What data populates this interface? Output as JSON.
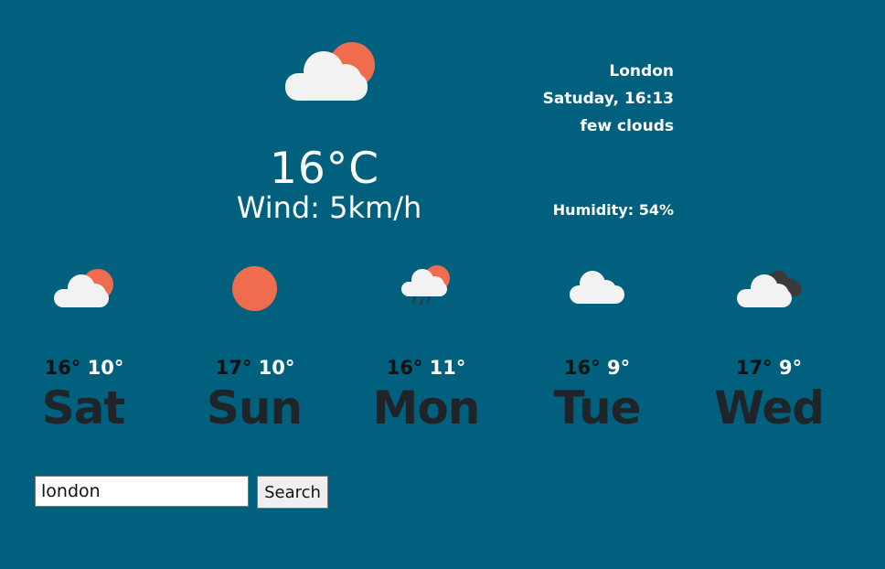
{
  "current": {
    "icon": "few-clouds-icon",
    "temperature": "16°C",
    "wind": "Wind: 5km/h",
    "city": "London",
    "datetime": "Satuday, 16:13",
    "description": "few clouds",
    "humidity": "Humidity: 54%"
  },
  "forecast": [
    {
      "day": "Sat",
      "max": "16°",
      "min": "10°",
      "icon": "few-clouds-icon"
    },
    {
      "day": "Sun",
      "max": "17°",
      "min": "10°",
      "icon": "clear-sky-icon"
    },
    {
      "day": "Mon",
      "max": "16°",
      "min": "11°",
      "icon": "light-rain-icon"
    },
    {
      "day": "Tue",
      "max": "16°",
      "min": "9°",
      "icon": "cloud-icon"
    },
    {
      "day": "Wed",
      "max": "17°",
      "min": "9°",
      "icon": "overcast-clouds-icon"
    }
  ],
  "search": {
    "value": "london",
    "button_label": "Search"
  },
  "colors": {
    "background": "#00607d",
    "sun": "#ef6d4e",
    "cloud": "#f2f2f2",
    "dark_cloud": "#3a3a3a",
    "day_text": "#1f2429"
  }
}
